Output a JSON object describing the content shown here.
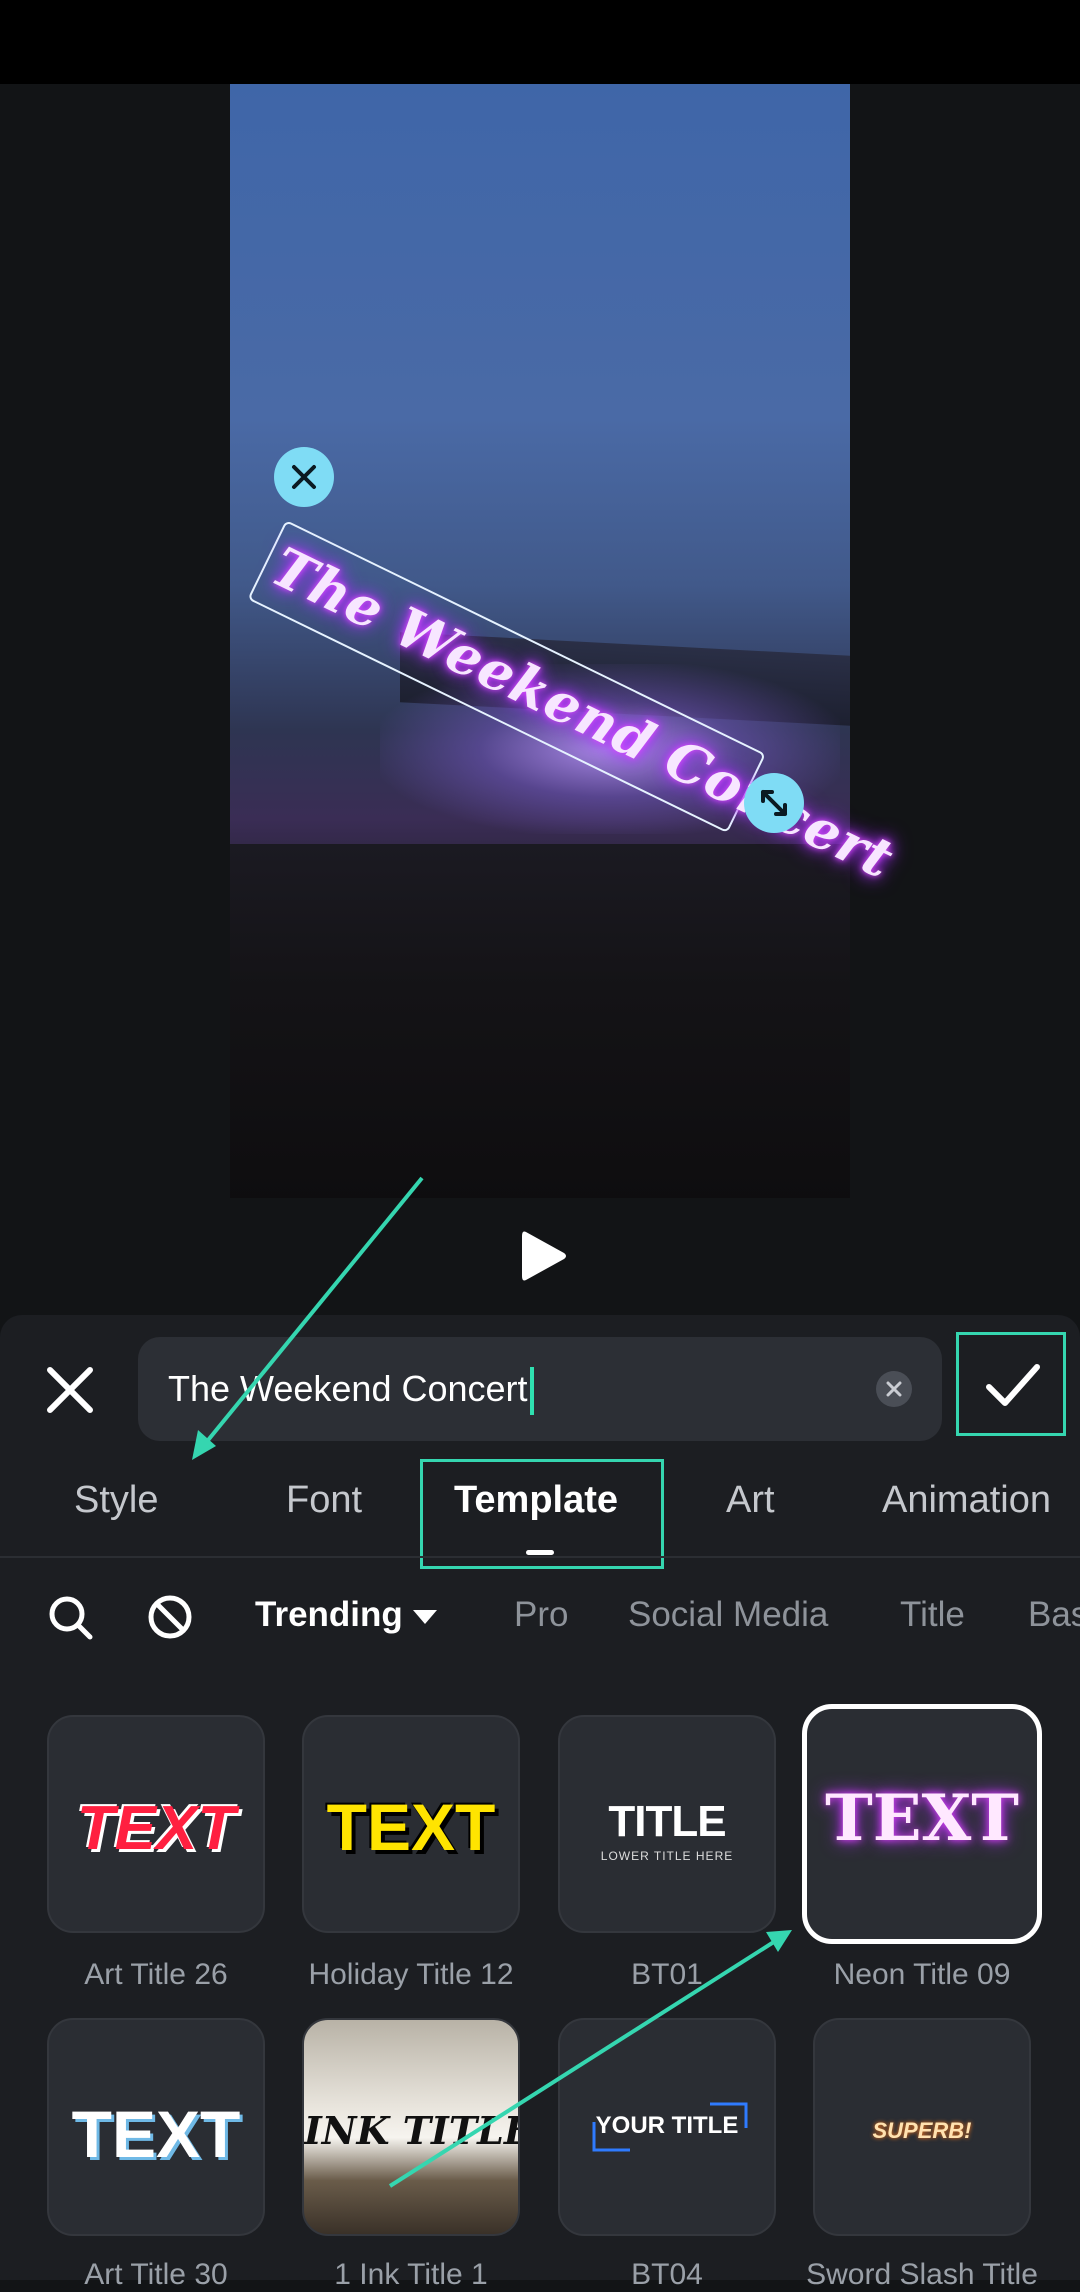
{
  "preview": {
    "overlay_text": "The Weekend Concert"
  },
  "editor": {
    "input_value": "The Weekend Concert"
  },
  "tabs": [
    {
      "label": "Style"
    },
    {
      "label": "Font"
    },
    {
      "label": "Template",
      "active": true
    },
    {
      "label": "Art"
    },
    {
      "label": "Animation"
    }
  ],
  "filters": {
    "selected": "Trending",
    "items": [
      "Pro",
      "Social Media",
      "Title",
      "Basic"
    ]
  },
  "templates": [
    {
      "label": "Art Title 26",
      "thumb": "TEXT"
    },
    {
      "label": "Holiday Title 12",
      "thumb": "TEXT"
    },
    {
      "label": "BT01",
      "thumb": "TITLE",
      "thumb_sub": "LOWER TITLE HERE"
    },
    {
      "label": "Neon Title 09",
      "thumb": "TEXT",
      "selected": true
    },
    {
      "label": "Art Title 30",
      "thumb": "TEXT"
    },
    {
      "label": "1 Ink Title 1",
      "thumb": "INK TITLE"
    },
    {
      "label": "BT04",
      "thumb": "YOUR TITLE"
    },
    {
      "label": "Sword Slash Title",
      "thumb": "SUPERB!"
    }
  ],
  "colors": {
    "accent": "#35d6b0",
    "handle": "#7fdcf5",
    "neon": "#e040ff"
  }
}
